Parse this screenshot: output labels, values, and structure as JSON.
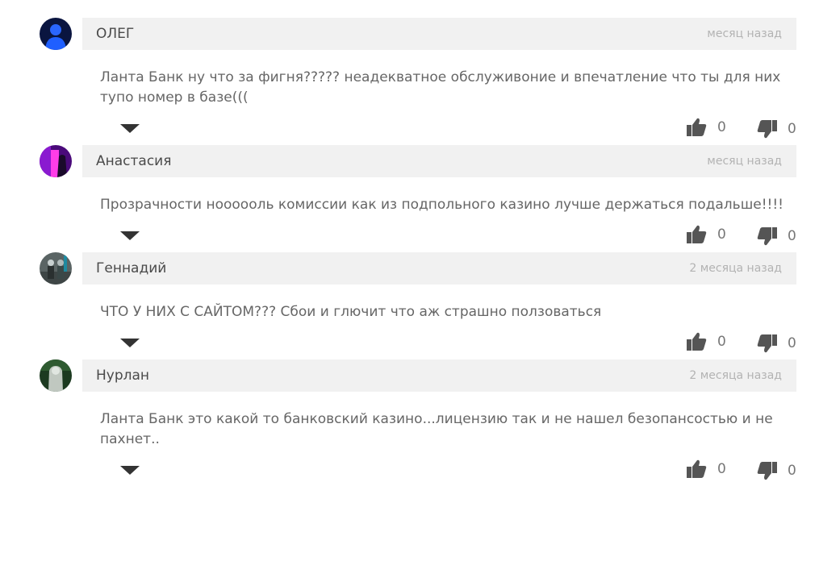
{
  "comments": [
    {
      "author": "ОЛЕГ",
      "time": "месяц назад",
      "text": "Ланта Банк ну что за фигня????? неадекватное обслуживоние и впечатление что ты для них тупо номер в базе(((",
      "likes": "0",
      "dislikes": "0",
      "avatar_colors": [
        "#0a1a6e",
        "#1f5fff"
      ]
    },
    {
      "author": "Анастасия",
      "time": "месяц назад",
      "text": "Прозрачности ноооооль комиссии как из подпольного казино лучше держаться подальше!!!!",
      "likes": "0",
      "dislikes": "0",
      "avatar_colors": [
        "#6a0aa8",
        "#ff3de8"
      ]
    },
    {
      "author": "Геннадий",
      "time": "2 месяца назад",
      "text": "ЧТО У НИХ С САЙТОМ??? Сбои и глючит что аж страшно ползоваться",
      "likes": "0",
      "dislikes": "0",
      "avatar_colors": [
        "#3e4a4a",
        "#9aa6a6"
      ]
    },
    {
      "author": "Нурлан",
      "time": "2 месяца назад",
      "text": "Ланта Банк это какой то банковский казино...лицензию так и не нашел безопансостью и не пахнет..",
      "likes": "0",
      "dislikes": "0",
      "avatar_colors": [
        "#1f4a24",
        "#b8c4b8"
      ]
    }
  ],
  "icons": {
    "like": "thumbs-up-icon",
    "dislike": "thumbs-down-icon",
    "toggle": "caret-down-icon"
  }
}
